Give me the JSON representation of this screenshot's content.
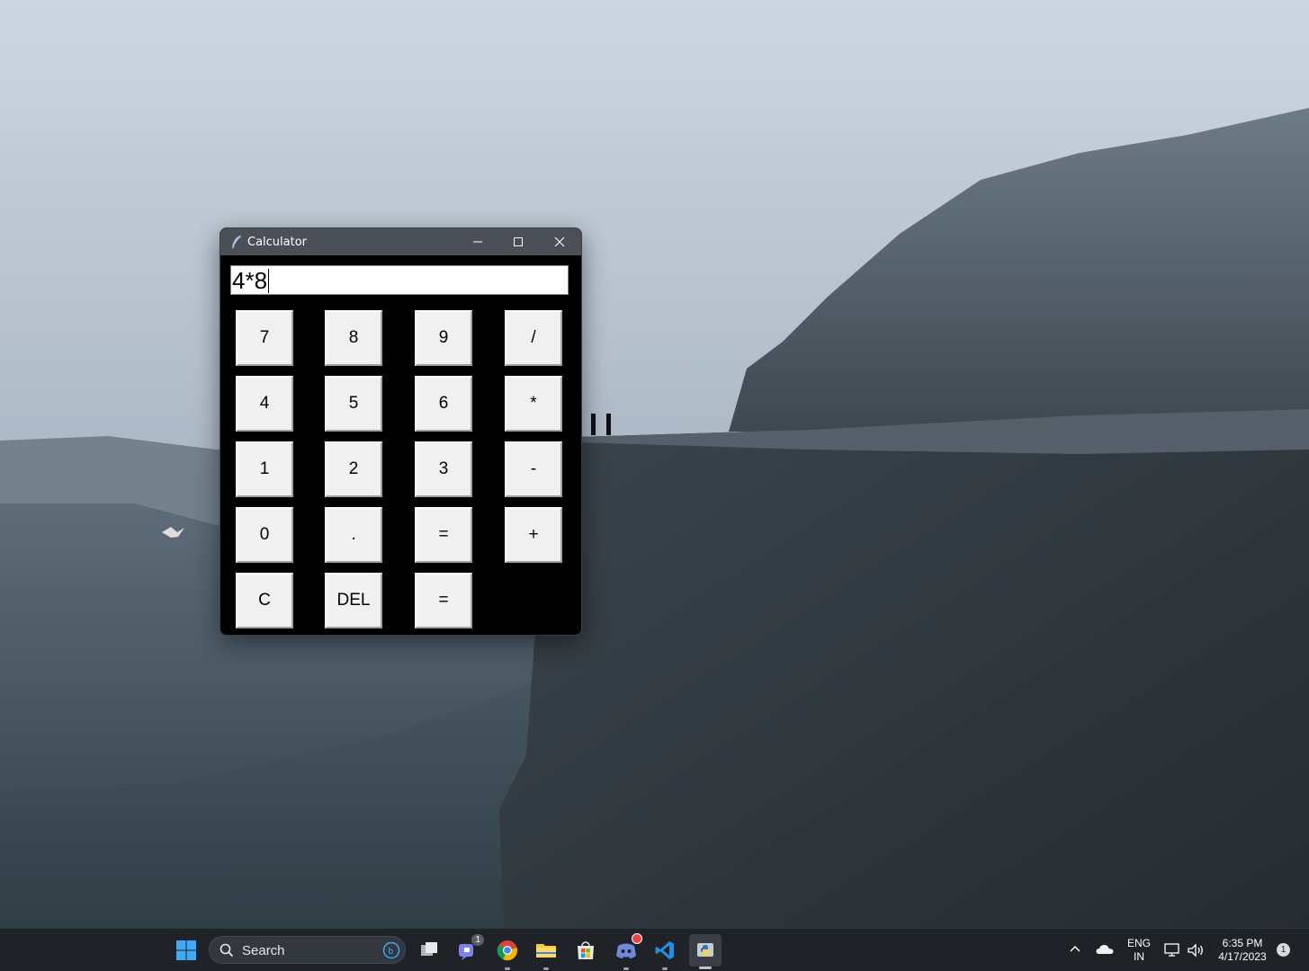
{
  "window": {
    "title": "Calculator",
    "display_value": "4*8"
  },
  "keypad": {
    "rows": [
      [
        "7",
        "8",
        "9",
        "/"
      ],
      [
        "4",
        "5",
        "6",
        "*"
      ],
      [
        "1",
        "2",
        "3",
        "-"
      ],
      [
        "0",
        ".",
        "=",
        "+"
      ],
      [
        "C",
        "DEL",
        "="
      ]
    ]
  },
  "taskbar": {
    "search_label": "Search",
    "teams_badge": "1",
    "language_line1": "ENG",
    "language_line2": "IN",
    "time": "6:35 PM",
    "date": "4/17/2023",
    "notification_count": "1"
  },
  "colors": {
    "titlebar": "#4a5055",
    "window_bg": "#000000",
    "key_bg": "#f0f0f0",
    "taskbar_bg": "#1f2327"
  }
}
